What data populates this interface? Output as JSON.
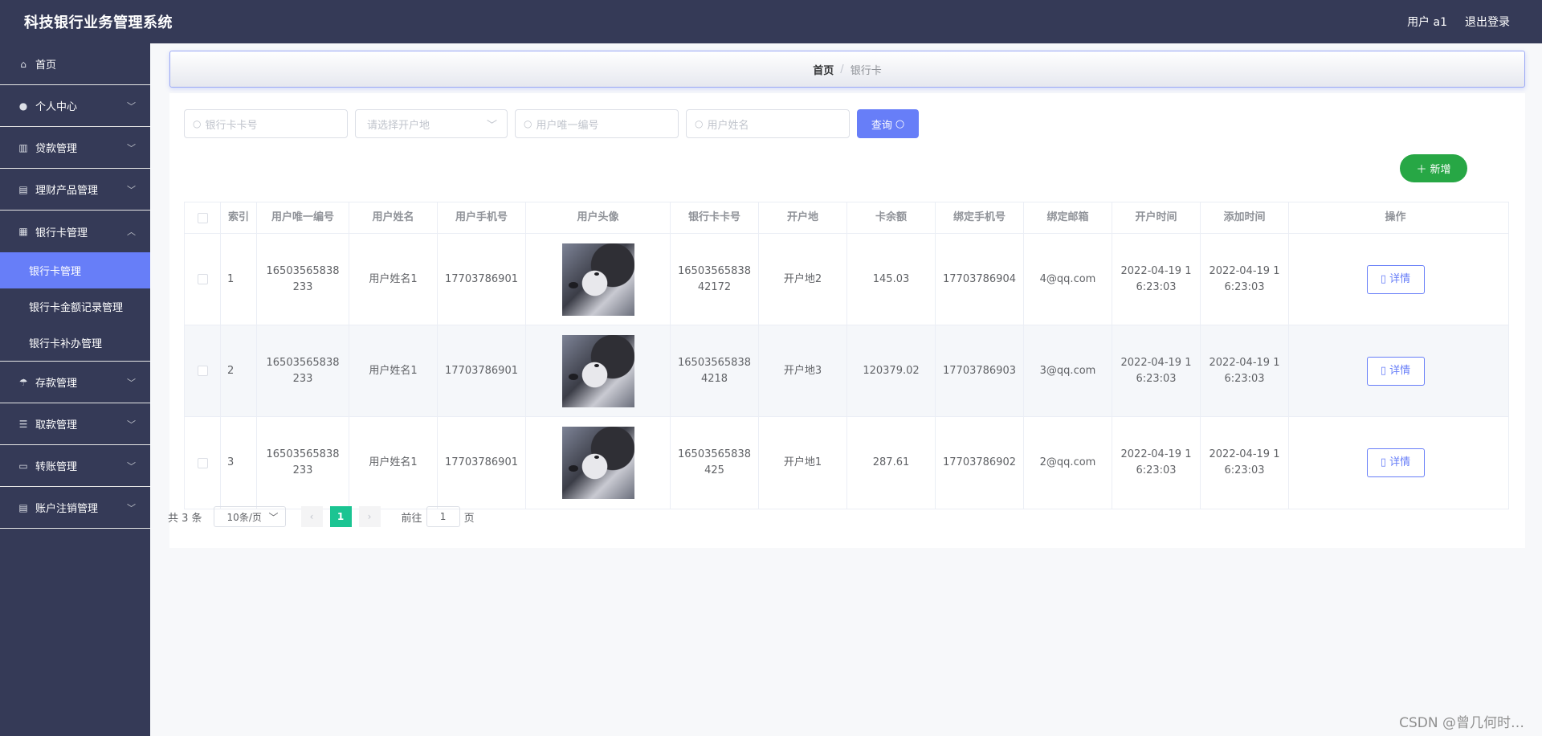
{
  "app": {
    "title": "科技银行业务管理系统",
    "user_label": "用户 a1",
    "logout": "退出登录"
  },
  "sidebar": {
    "items": [
      {
        "label": "首页",
        "icon": "home-icon"
      },
      {
        "label": "个人中心",
        "icon": "user-icon"
      },
      {
        "label": "贷款管理",
        "icon": "books-icon"
      },
      {
        "label": "理财产品管理",
        "icon": "clipboard-icon"
      },
      {
        "label": "银行卡管理",
        "icon": "grid-icon",
        "expanded": true
      },
      {
        "label": "存款管理",
        "icon": "umbrella-icon"
      },
      {
        "label": "取款管理",
        "icon": "list-icon"
      },
      {
        "label": "转账管理",
        "icon": "monitor-icon"
      },
      {
        "label": "账户注销管理",
        "icon": "clipboard-icon"
      }
    ],
    "submenu": [
      {
        "label": "银行卡管理",
        "active": true
      },
      {
        "label": "银行卡金额记录管理"
      },
      {
        "label": "银行卡补办管理"
      }
    ]
  },
  "breadcrumb": {
    "home": "首页",
    "sep": "/",
    "current": "银行卡"
  },
  "search": {
    "card_no_placeholder": "银行卡卡号",
    "location_placeholder": "请选择开户地",
    "user_id_placeholder": "用户唯一编号",
    "user_name_placeholder": "用户姓名",
    "query_label": "查询"
  },
  "add_label": "新增",
  "table": {
    "headers": [
      "索引",
      "用户唯一编号",
      "用户姓名",
      "用户手机号",
      "用户头像",
      "银行卡卡号",
      "开户地",
      "卡余额",
      "绑定手机号",
      "绑定邮箱",
      "开户时间",
      "添加时间",
      "操作"
    ],
    "rows": [
      {
        "index": "1",
        "user_id": "16503565838233",
        "user_name": "用户姓名1",
        "phone": "17703786901",
        "card_no": "1650356583842172",
        "location": "开户地2",
        "balance": "145.03",
        "bind_phone": "17703786904",
        "email": "4@qq.com",
        "open_time": "2022-04-19 16:23:03",
        "add_time": "2022-04-19 16:23:03",
        "action": "详情"
      },
      {
        "index": "2",
        "user_id": "16503565838233",
        "user_name": "用户姓名1",
        "phone": "17703786901",
        "card_no": "165035658384218",
        "location": "开户地3",
        "balance": "120379.02",
        "bind_phone": "17703786903",
        "email": "3@qq.com",
        "open_time": "2022-04-19 16:23:03",
        "add_time": "2022-04-19 16:23:03",
        "action": "详情"
      },
      {
        "index": "3",
        "user_id": "16503565838233",
        "user_name": "用户姓名1",
        "phone": "17703786901",
        "card_no": "16503565838425",
        "location": "开户地1",
        "balance": "287.61",
        "bind_phone": "17703786902",
        "email": "2@qq.com",
        "open_time": "2022-04-19 16:23:03",
        "add_time": "2022-04-19 16:23:03",
        "action": "详情"
      }
    ]
  },
  "pager": {
    "total": "共 3 条",
    "page_size": "10条/页",
    "current": "1",
    "goto": "前往",
    "jump_value": "1",
    "page_unit": "页"
  },
  "watermark": "CSDN @曾几何时…",
  "colors": {
    "primary": "#677ef8",
    "sidebar": "#353a57",
    "add": "#27a745",
    "pager_active": "#1bc492"
  }
}
